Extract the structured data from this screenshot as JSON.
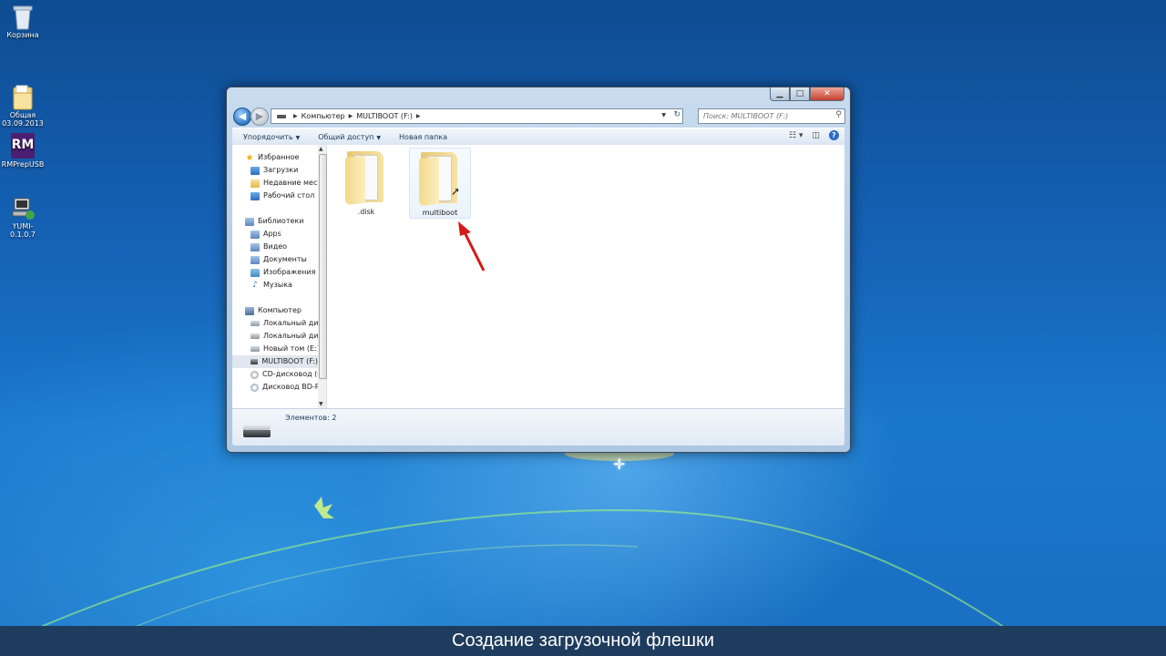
{
  "desktop": {
    "icons": [
      {
        "label": "Корзина",
        "icon": "recycle-bin-icon"
      },
      {
        "label": "Общая\n03.09.2013",
        "icon": "folder-icon"
      },
      {
        "label": "RMPrepUSB",
        "icon": "rmprepusb-icon",
        "badge": "RM"
      },
      {
        "label": "YUMI-0.1.0.7",
        "icon": "yumi-icon"
      }
    ]
  },
  "window": {
    "address": {
      "crumbs": [
        "Компьютер",
        "MULTIBOOT (F:)"
      ]
    },
    "search": {
      "placeholder": "Поиск: MULTIBOOT (F:)"
    },
    "toolbar": {
      "organize": "Упорядочить",
      "share": "Общий доступ",
      "new_folder": "Новая папка"
    },
    "nav": {
      "favorites": "Избранное",
      "downloads": "Загрузки",
      "recent": "Недавние места",
      "desktop": "Рабочий стол",
      "libraries": "Библиотеки",
      "apps": "Apps",
      "video": "Видео",
      "documents": "Документы",
      "pictures": "Изображения",
      "music": "Музыка",
      "computer": "Компьютер",
      "local1": "Локальный диск",
      "local2": "Локальный диск",
      "newvol": "Новый том (E:)",
      "multiboot": "MULTIBOOT (F:)",
      "cd": "CD-дисковод (G",
      "bd": "Дисковод BD-RO"
    },
    "files": [
      {
        "name": ".disk"
      },
      {
        "name": "multiboot"
      }
    ],
    "details": {
      "count": "Элементов: 2"
    }
  },
  "caption": "Создание загрузочной флешки"
}
